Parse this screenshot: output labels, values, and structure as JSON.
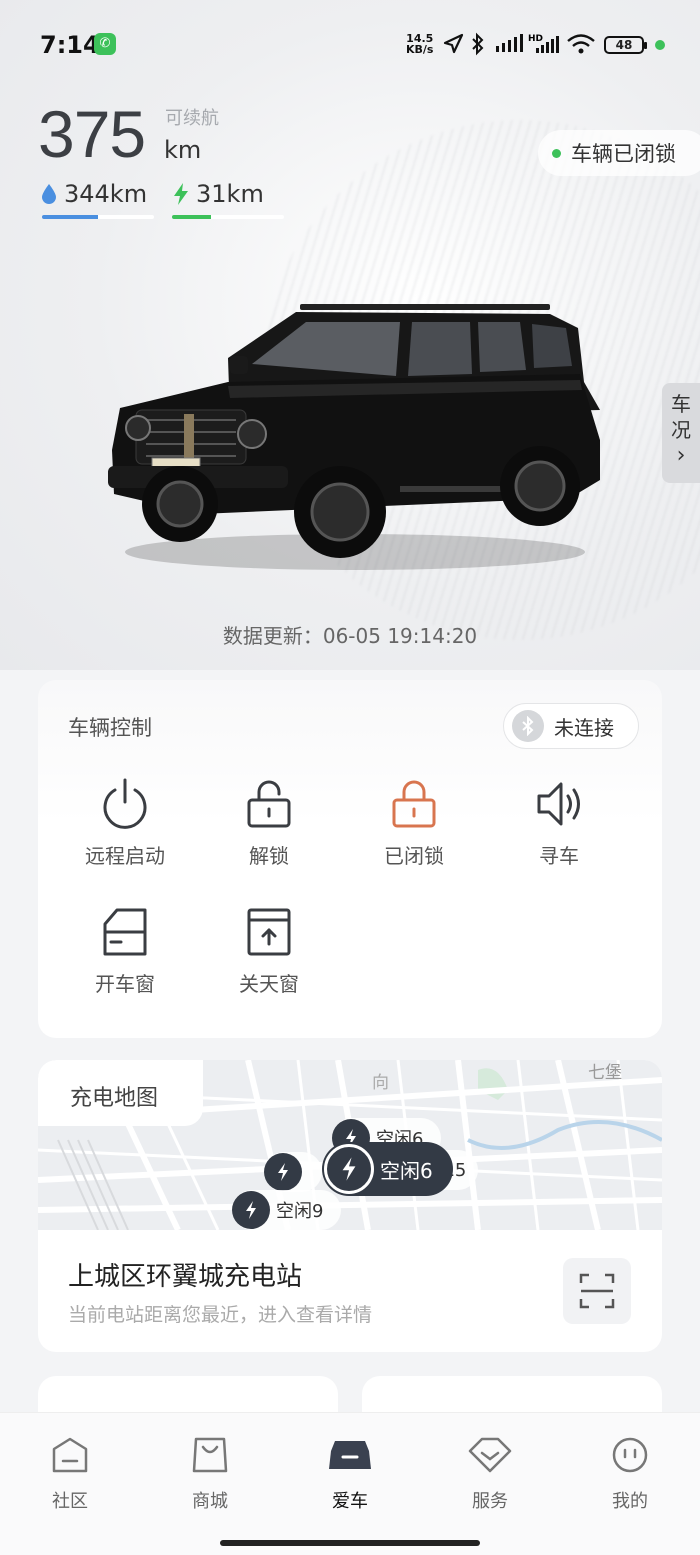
{
  "status_bar": {
    "time": "7:14",
    "speed_top": "14.5",
    "speed_bottom": "KB/s",
    "battery": "48"
  },
  "range": {
    "total": "375",
    "label": "可续航",
    "unit": "km",
    "fuel": "344km",
    "electric": "31km",
    "fuel_fraction": 0.5,
    "electric_fraction": 0.35
  },
  "vehicle_status": "车辆已闭锁",
  "side_tab": [
    "车",
    "况"
  ],
  "update_time": "数据更新：06-05 19:14:20",
  "control": {
    "title": "车辆控制",
    "bluetooth_status": "未连接",
    "items": [
      {
        "label": "远程启动",
        "icon": "power-icon"
      },
      {
        "label": "解锁",
        "icon": "unlock-icon"
      },
      {
        "label": "已闭锁",
        "icon": "lock-icon"
      },
      {
        "label": "寻车",
        "icon": "speaker-icon"
      },
      {
        "label": "开车窗",
        "icon": "window-open-icon"
      },
      {
        "label": "关天窗",
        "icon": "sunroof-close-icon"
      }
    ],
    "lock_color": "#d8754f"
  },
  "charging_map": {
    "title": "充电地图",
    "station_name": "上城区环翼城充电站",
    "station_desc": "当前电站距离您最近，进入查看详情",
    "pins": [
      {
        "label": "空闲6"
      },
      {
        "label": "空闲6"
      },
      {
        "label": "空闲9"
      },
      {
        "label": "115"
      }
    ],
    "map_labels": [
      "七堡",
      "向"
    ]
  },
  "tabs": [
    {
      "label": "社区",
      "icon": "community-icon"
    },
    {
      "label": "商城",
      "icon": "shop-bag-icon"
    },
    {
      "label": "爱车",
      "icon": "car-icon"
    },
    {
      "label": "服务",
      "icon": "service-icon"
    },
    {
      "label": "我的",
      "icon": "profile-icon"
    }
  ],
  "colors": {
    "fuel": "#4a8fe0",
    "electric": "#3dc15a",
    "active_tab": "#3a4150"
  }
}
